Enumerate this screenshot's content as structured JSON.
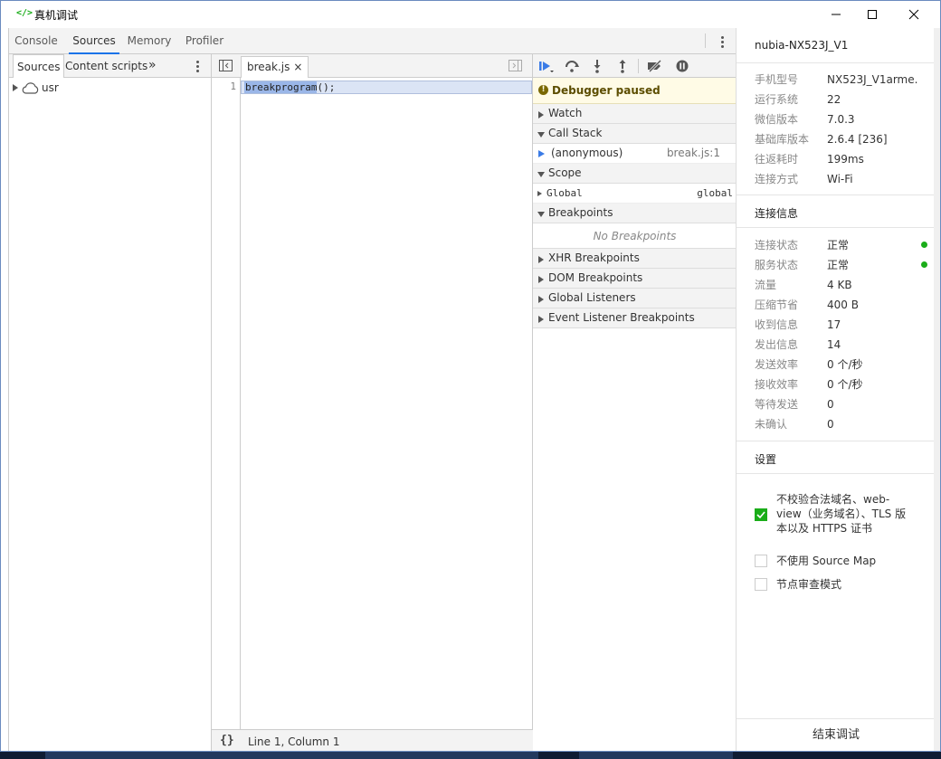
{
  "window": {
    "app_icon": "</>",
    "title": "真机调试",
    "controls": [
      "minimize-icon",
      "maximize-icon",
      "close-icon"
    ]
  },
  "devtools": {
    "tabs": [
      {
        "label": "Console",
        "active": false
      },
      {
        "label": "Sources",
        "active": true
      },
      {
        "label": "Memory",
        "active": false
      },
      {
        "label": "Profiler",
        "active": false
      }
    ],
    "navigator": {
      "tabs": [
        {
          "label": "Sources",
          "active": true
        },
        {
          "label": "Content scripts",
          "active": false
        }
      ],
      "more": "»",
      "tree": [
        {
          "label": "usr",
          "icon": "cloud-icon",
          "expanded": false
        }
      ]
    },
    "editor": {
      "file_tab": "break.js",
      "close": "×",
      "lines": [
        {
          "number": "1",
          "selected": "breakprogram",
          "rest": "();"
        }
      ],
      "format_button": "{}",
      "cursor_position": "Line 1, Column 1"
    },
    "debugger": {
      "paused_icon": "!",
      "paused_message": "Debugger paused",
      "sections": {
        "watch": "Watch",
        "call_stack": "Call Stack",
        "scope": "Scope",
        "breakpoints": "Breakpoints",
        "xhr": "XHR Breakpoints",
        "dom": "DOM Breakpoints",
        "global_listeners": "Global Listeners",
        "event_listener": "Event Listener Breakpoints"
      },
      "call_frame": {
        "name": "(anonymous)",
        "location": "break.js:1"
      },
      "scope_row": {
        "name": "Global",
        "value": "global"
      },
      "no_breakpoints": "No Breakpoints"
    }
  },
  "device_panel": {
    "device_name": "nubia-NX523J_V1",
    "device_info": [
      {
        "key": "手机型号",
        "value": "NX523J_V1arme..."
      },
      {
        "key": "运行系统",
        "value": "22"
      },
      {
        "key": "微信版本",
        "value": "7.0.3"
      },
      {
        "key": "基础库版本",
        "value": "2.6.4 [236]"
      },
      {
        "key": "往返耗时",
        "value": "199ms"
      },
      {
        "key": "连接方式",
        "value": "Wi-Fi"
      }
    ],
    "connection_heading": "连接信息",
    "connection_info": [
      {
        "key": "连接状态",
        "value": "正常",
        "status": true
      },
      {
        "key": "服务状态",
        "value": "正常",
        "status": true
      },
      {
        "key": "流量",
        "value": "4 KB"
      },
      {
        "key": "压缩节省",
        "value": "400 B"
      },
      {
        "key": "收到信息",
        "value": "17"
      },
      {
        "key": "发出信息",
        "value": "14"
      },
      {
        "key": "发送效率",
        "value": "0 个/秒"
      },
      {
        "key": "接收效率",
        "value": "0 个/秒"
      },
      {
        "key": "等待发送",
        "value": "0"
      },
      {
        "key": "未确认",
        "value": "0"
      }
    ],
    "settings_heading": "设置",
    "settings": [
      {
        "lines": [
          "不校验合法域名、web-",
          "view（业务域名）、TLS 版",
          "本以及 HTTPS 证书"
        ],
        "checked": true
      },
      {
        "lines": [
          "不使用 Source Map"
        ],
        "checked": false
      },
      {
        "lines": [
          "节点审查模式"
        ],
        "checked": false
      }
    ],
    "end_button": "结束调试"
  },
  "colors": {
    "accent": "#1a73e8",
    "wechat_green": "#1aad19",
    "paused_bg": "#fffbe6",
    "selection": "#9ab6e8"
  }
}
